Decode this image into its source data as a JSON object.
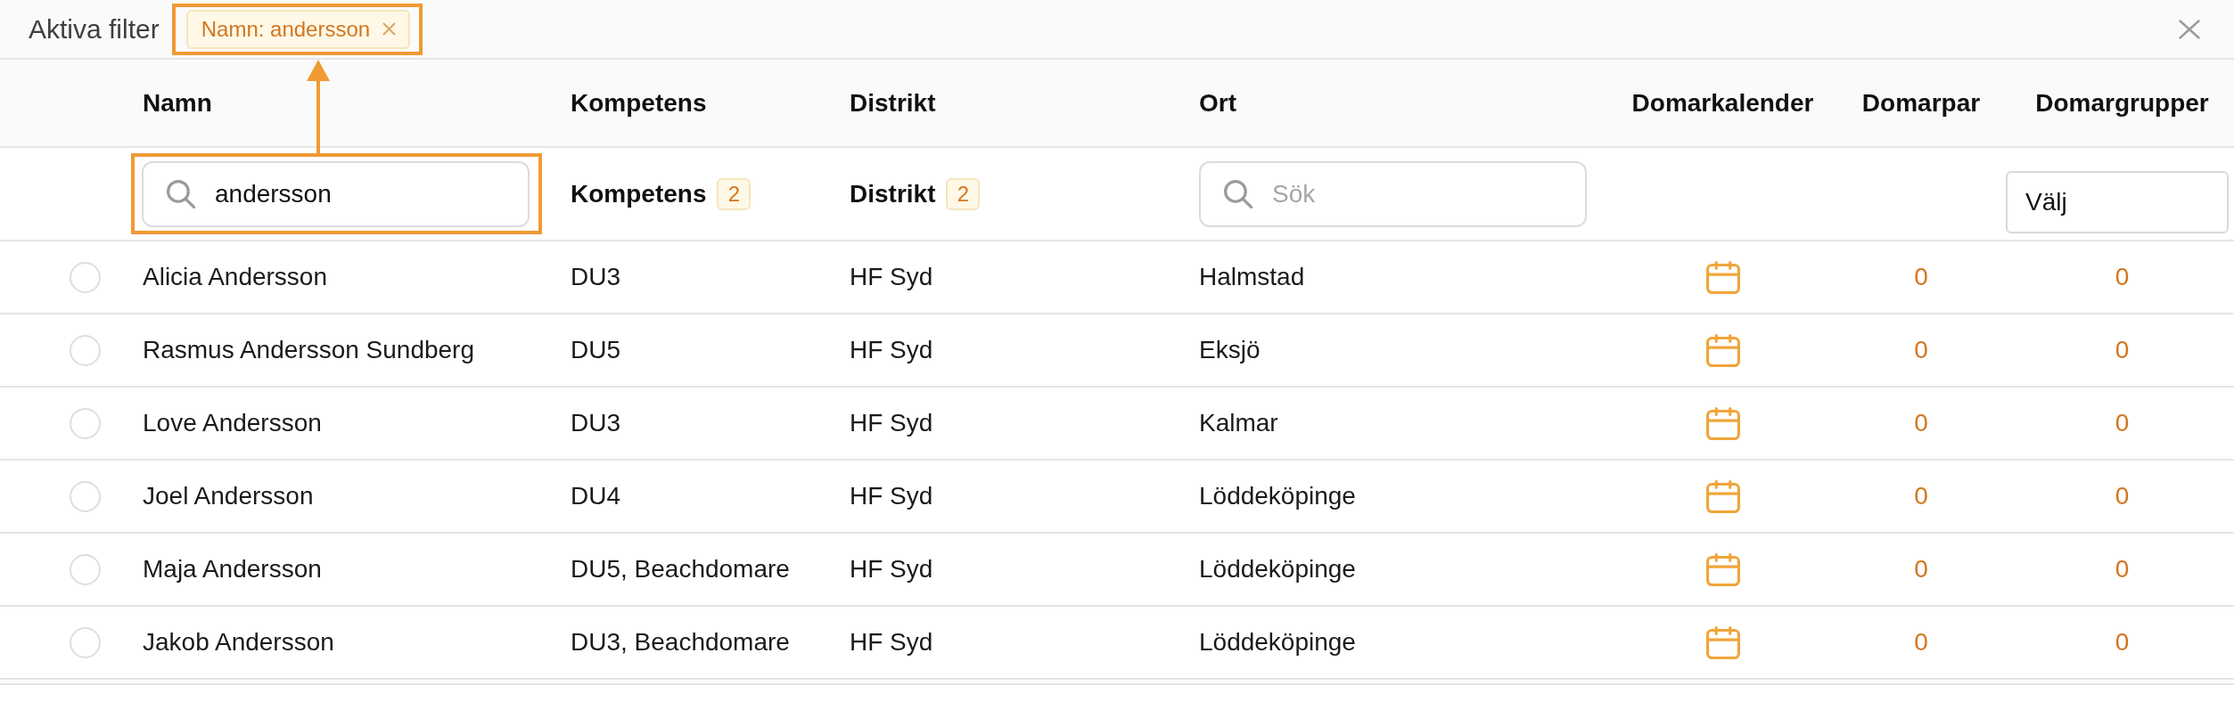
{
  "filter_bar": {
    "label": "Aktiva filter",
    "chips": [
      {
        "label": "Namn: andersson",
        "highlighted": true
      }
    ]
  },
  "table": {
    "columns": [
      {
        "label": "Namn"
      },
      {
        "label": "Kompetens"
      },
      {
        "label": "Distrikt"
      },
      {
        "label": "Ort"
      },
      {
        "label": "Domarkalender"
      },
      {
        "label": "Domarpar"
      },
      {
        "label": "Domargrupper"
      }
    ],
    "filters": {
      "namn": {
        "kind": "search",
        "value": "andersson",
        "highlighted": true
      },
      "kompetens": {
        "kind": "facet",
        "label": "Kompetens",
        "count": "2"
      },
      "distrikt": {
        "kind": "facet",
        "label": "Distrikt",
        "count": "2"
      },
      "ort": {
        "kind": "search",
        "placeholder": "Sök",
        "highlighted": false
      },
      "domargrupper": {
        "kind": "select",
        "label": "Välj"
      }
    },
    "rows": [
      {
        "selected": false,
        "name": "Alicia Andersson",
        "kompetens": "DU3",
        "distrikt": "HF Syd",
        "ort": "Halmstad",
        "domarpar": "0",
        "domargrupper": "0"
      },
      {
        "selected": false,
        "name": "Rasmus Andersson Sundberg",
        "kompetens": "DU5",
        "distrikt": "HF Syd",
        "ort": "Eksjö",
        "domarpar": "0",
        "domargrupper": "0"
      },
      {
        "selected": false,
        "name": "Love Andersson",
        "kompetens": "DU3",
        "distrikt": "HF Syd",
        "ort": "Kalmar",
        "domarpar": "0",
        "domargrupper": "0"
      },
      {
        "selected": false,
        "name": "Joel Andersson",
        "kompetens": "DU4",
        "distrikt": "HF Syd",
        "ort": "Löddeköpinge",
        "domarpar": "0",
        "domargrupper": "0"
      },
      {
        "selected": false,
        "name": "Maja Andersson",
        "kompetens": "DU5, Beachdomare",
        "distrikt": "HF Syd",
        "ort": "Löddeköpinge",
        "domarpar": "0",
        "domargrupper": "0"
      },
      {
        "selected": false,
        "name": "Jakob Andersson",
        "kompetens": "DU3, Beachdomare",
        "distrikt": "HF Syd",
        "ort": "Löddeköpinge",
        "domarpar": "0",
        "domargrupper": "0"
      }
    ]
  }
}
